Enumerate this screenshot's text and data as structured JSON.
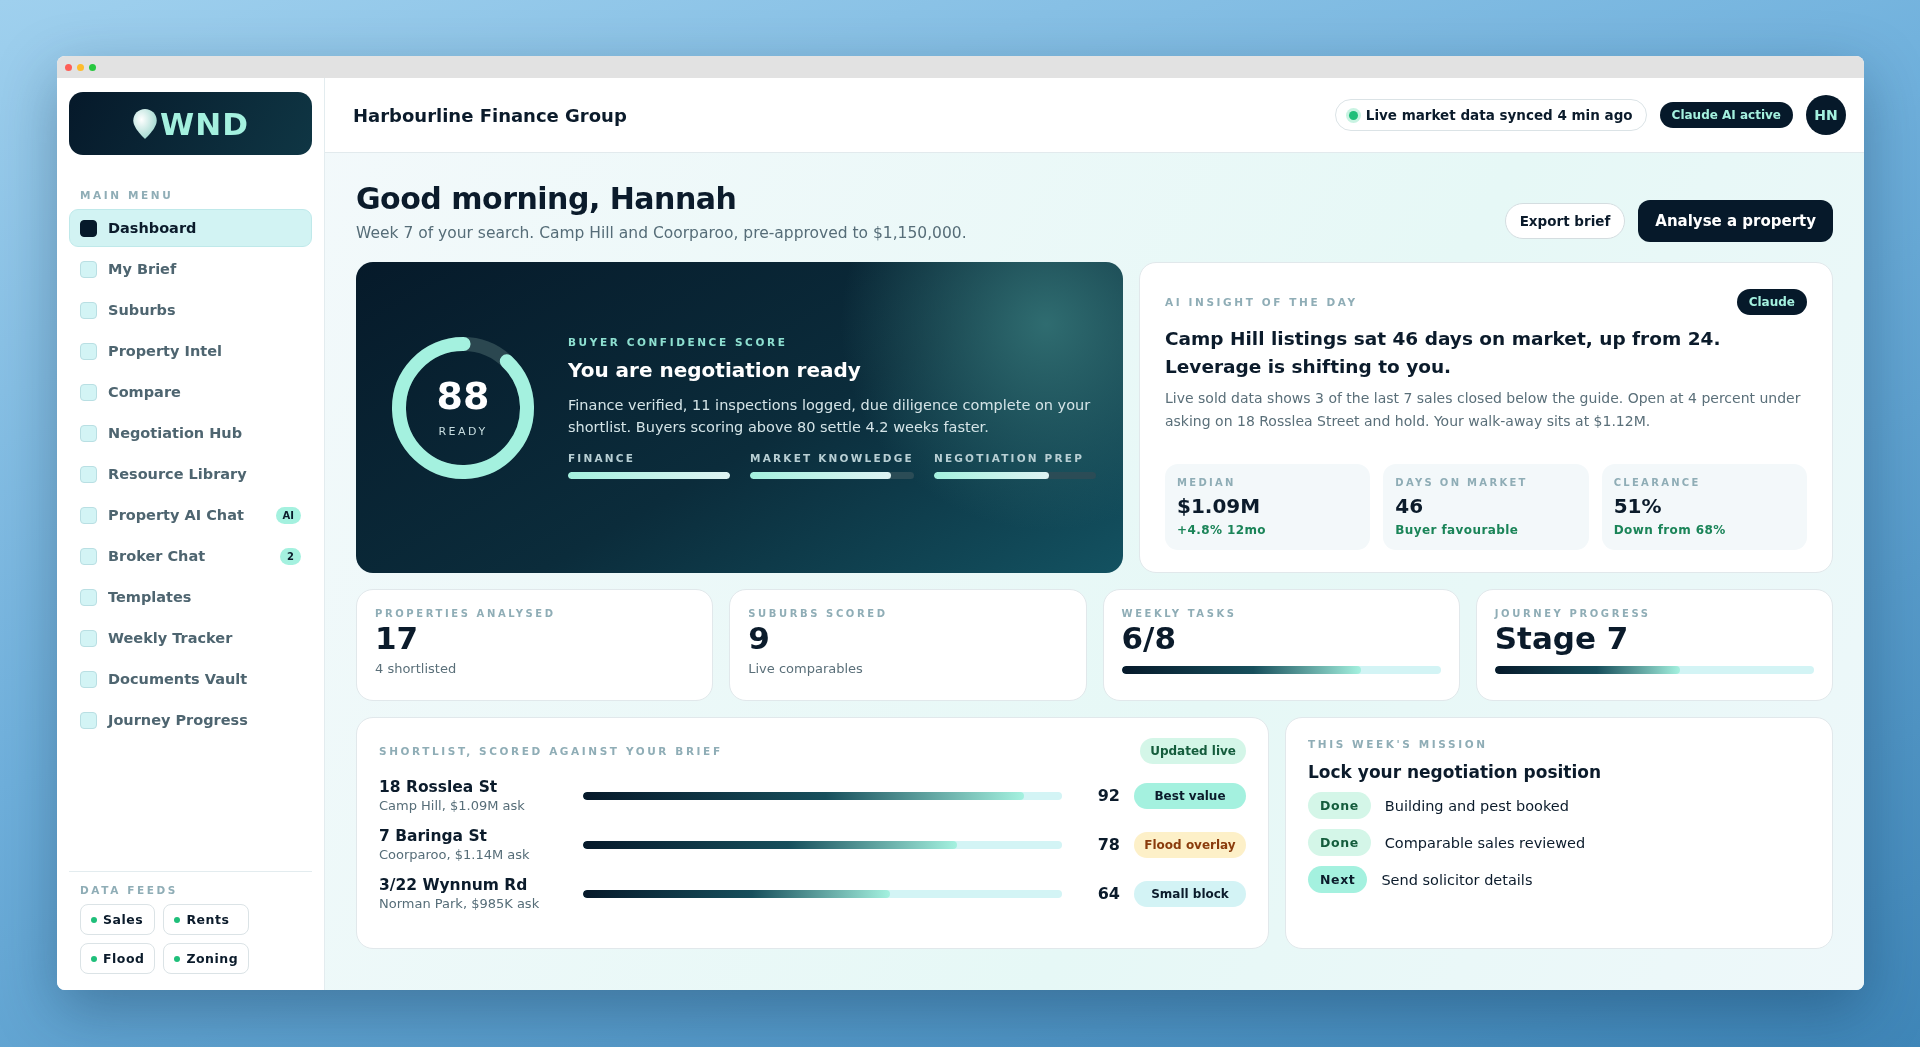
{
  "sidebar": {
    "logo": "WND",
    "menu_heading": "MAIN MENU",
    "items": [
      {
        "label": "Dashboard",
        "selected": true
      },
      {
        "label": "My Brief",
        "selected": false
      },
      {
        "label": "Suburbs",
        "selected": false
      },
      {
        "label": "Property Intel",
        "selected": false
      },
      {
        "label": "Compare",
        "selected": false
      },
      {
        "label": "Negotiation Hub",
        "selected": false
      },
      {
        "label": "Resource Library",
        "selected": false
      },
      {
        "label": "Property AI Chat",
        "selected": false,
        "badge": "AI"
      },
      {
        "label": "Broker Chat",
        "selected": false,
        "badge": "2"
      },
      {
        "label": "Templates",
        "selected": false
      },
      {
        "label": "Weekly Tracker",
        "selected": false
      },
      {
        "label": "Documents Vault",
        "selected": false
      },
      {
        "label": "Journey Progress",
        "selected": false
      }
    ],
    "feeds_heading": "DATA FEEDS",
    "feeds": [
      "Sales",
      "Rents",
      "Flood",
      "Zoning"
    ]
  },
  "header": {
    "title": "Harbourline Finance Group",
    "sync_status": "Live market data synced 4 min ago",
    "ai_badge": "Claude AI active",
    "avatar": "HN"
  },
  "greeting": {
    "title": "Good morning, Hannah",
    "subtitle": "Week 7 of your search. Camp Hill and Coorparoo, pre-approved to $1,150,000."
  },
  "actions": [
    {
      "label": "Export brief",
      "kind": "secondary"
    },
    {
      "label": "Analyse a property",
      "kind": "primary"
    }
  ],
  "confidence": {
    "score": "88",
    "score_label": "READY",
    "eyebrow": "BUYER CONFIDENCE SCORE",
    "title": "You are negotiation ready",
    "text": "Finance verified, 11 inspections logged, due diligence complete on your shortlist. Buyers scoring above 80 settle 4.2 weeks faster.",
    "bars": [
      {
        "label": "FINANCE",
        "level": 1
      },
      {
        "label": "MARKET KNOWLEDGE",
        "level": 0.86
      },
      {
        "label": "NEGOTIATION PREP",
        "level": 0.71
      }
    ]
  },
  "insight": {
    "eyebrow": "AI INSIGHT OF THE DAY",
    "badge": "Claude",
    "headline": "Camp Hill listings sat 46 days on market, up from 24. Leverage is shifting to you.",
    "text": "Live sold data shows 3 of the last 7 sales closed below the guide. Open at 4 percent under asking on 18 Rosslea Street and hold. Your walk-away sits at $1.12M.",
    "metrics": [
      {
        "label": "MEDIAN",
        "value": "$1.09M",
        "note": "+4.8% 12mo"
      },
      {
        "label": "DAYS ON MARKET",
        "value": "46",
        "note": "Buyer favourable"
      },
      {
        "label": "CLEARANCE",
        "value": "51%",
        "note": "Down from 68%"
      }
    ]
  },
  "stats": [
    {
      "kind": "note",
      "label": "PROPERTIES ANALYSED",
      "value": "17",
      "note": "4 shortlisted"
    },
    {
      "kind": "note",
      "label": "SUBURBS SCORED",
      "value": "9",
      "note": "Live comparables"
    },
    {
      "kind": "progress",
      "label": "WEEKLY TASKS",
      "value": "6/8",
      "level": 0.75
    },
    {
      "kind": "progress",
      "label": "JOURNEY PROGRESS",
      "value": "Stage 7",
      "level": 0.58
    }
  ],
  "shortlist": {
    "eyebrow": "SHORTLIST, SCORED AGAINST YOUR BRIEF",
    "badge": "Updated live",
    "rows": [
      {
        "address": "18 Rosslea St",
        "detail": "Camp Hill, $1.09M ask",
        "level": 0.92,
        "score": "92",
        "tag": "Best value",
        "kind": "good"
      },
      {
        "address": "7 Baringa St",
        "detail": "Coorparoo, $1.14M ask",
        "level": 0.78,
        "score": "78",
        "tag": "Flood overlay",
        "kind": "warn"
      },
      {
        "address": "3/22 Wynnum Rd",
        "detail": "Norman Park, $985K ask",
        "level": 0.64,
        "score": "64",
        "tag": "Small block",
        "kind": "info"
      }
    ]
  },
  "mission": {
    "eyebrow": "THIS WEEK'S MISSION",
    "title": "Lock your negotiation position",
    "tasks": [
      {
        "kind": "done",
        "status": "Done",
        "text": "Building and pest booked"
      },
      {
        "kind": "done",
        "status": "Done",
        "text": "Comparable sales reviewed"
      },
      {
        "kind": "next",
        "status": "Next",
        "text": "Send solicitor details"
      }
    ]
  }
}
